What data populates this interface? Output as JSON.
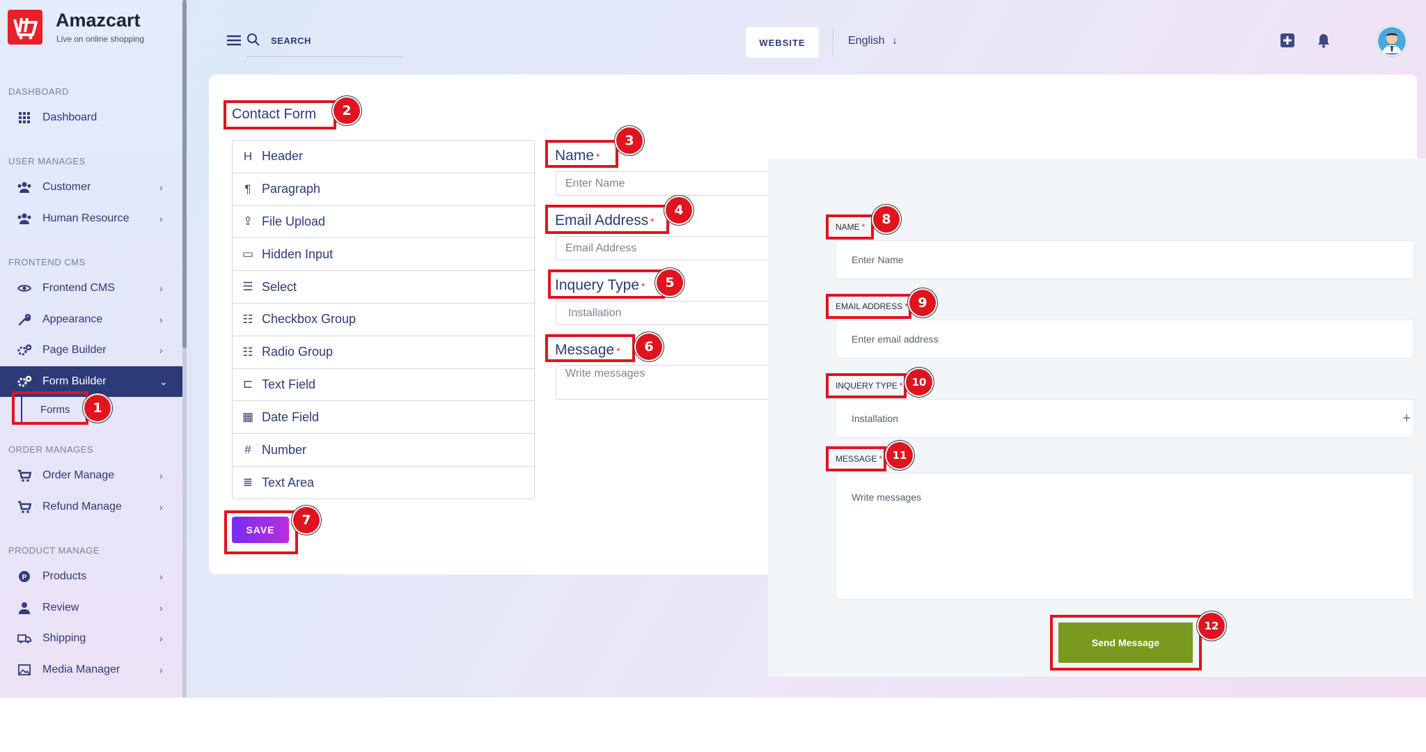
{
  "brand": {
    "title": "Amazcart",
    "subtitle": "Live on online shopping"
  },
  "sidebar": {
    "sections": [
      {
        "title": "DASHBOARD",
        "items": [
          {
            "label": "Dashboard",
            "icon": "grid-icon"
          }
        ]
      },
      {
        "title": "USER MANAGES",
        "items": [
          {
            "label": "Customer",
            "icon": "users-icon"
          },
          {
            "label": "Human Resource",
            "icon": "users-icon"
          }
        ]
      },
      {
        "title": "FRONTEND CMS",
        "items": [
          {
            "label": "Frontend CMS",
            "icon": "eye-icon"
          },
          {
            "label": "Appearance",
            "icon": "wrench-icon"
          },
          {
            "label": "Page Builder",
            "icon": "gears-icon"
          },
          {
            "label": "Form Builder",
            "icon": "gears-icon",
            "active": true,
            "sub": [
              "Forms"
            ]
          }
        ]
      },
      {
        "title": "ORDER MANAGES",
        "items": [
          {
            "label": "Order Manage",
            "icon": "cart-icon"
          },
          {
            "label": "Refund Manage",
            "icon": "cart-icon"
          }
        ]
      },
      {
        "title": "PRODUCT MANAGE",
        "items": [
          {
            "label": "Products",
            "icon": "product-icon"
          },
          {
            "label": "Review",
            "icon": "user-icon"
          },
          {
            "label": "Shipping",
            "icon": "truck-icon"
          },
          {
            "label": "Media Manager",
            "icon": "image-icon"
          }
        ]
      }
    ]
  },
  "topbar": {
    "search_label": "SEARCH",
    "website_label": "WEBSITE",
    "language": "English"
  },
  "builder": {
    "title": "Contact Form",
    "components": [
      {
        "label": "Header",
        "icon": "H"
      },
      {
        "label": "Paragraph",
        "icon": "¶"
      },
      {
        "label": "File Upload",
        "icon": "⇪"
      },
      {
        "label": "Hidden Input",
        "icon": "▭"
      },
      {
        "label": "Select",
        "icon": "☰"
      },
      {
        "label": "Checkbox Group",
        "icon": "☷"
      },
      {
        "label": "Radio Group",
        "icon": "☷"
      },
      {
        "label": "Text Field",
        "icon": "⊏"
      },
      {
        "label": "Date Field",
        "icon": "▦"
      },
      {
        "label": "Number",
        "icon": "#"
      },
      {
        "label": "Text Area",
        "icon": "≣"
      }
    ],
    "save_label": "SAVE",
    "fields": [
      {
        "label": "Name",
        "placeholder": "Enter Name"
      },
      {
        "label": "Email Address",
        "placeholder": "Email Address"
      },
      {
        "label": "Inquery Type",
        "placeholder": "Installation"
      },
      {
        "label": "Message",
        "placeholder": "Write messages"
      }
    ],
    "required_mark": "*"
  },
  "preview": {
    "fields": [
      {
        "label": "NAME",
        "placeholder": "Enter Name"
      },
      {
        "label": "EMAIL ADDRESS",
        "placeholder": "Enter email address"
      },
      {
        "label": "INQUERY TYPE",
        "placeholder": "Installation"
      },
      {
        "label": "MESSAGE",
        "placeholder": "Write messages"
      }
    ],
    "select_plus": "+",
    "required_mark": "*",
    "send_label": "Send Message"
  },
  "annotations": [
    "1",
    "2",
    "3",
    "4",
    "5",
    "6",
    "7",
    "8",
    "9",
    "10",
    "11",
    "12"
  ],
  "colors": {
    "accent_red": "#e0141f",
    "sidebar_active": "#2d3a78",
    "save_gradient_start": "#7a2cf0",
    "save_gradient_end": "#b82ee0",
    "send_button": "#7a9a1f"
  }
}
